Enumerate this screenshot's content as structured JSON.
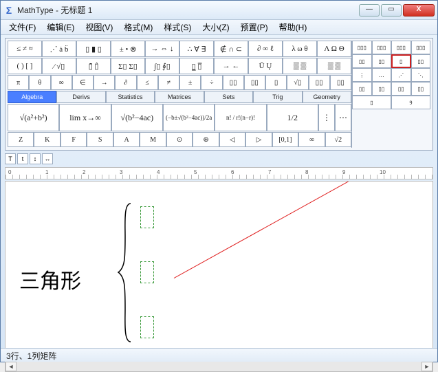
{
  "window": {
    "app_name": "MathType",
    "doc_title": "无标题 1",
    "title_full": "MathType - 无标题 1"
  },
  "win_buttons": {
    "min": "—",
    "max": "▭",
    "close": "X"
  },
  "menu": [
    "文件(F)",
    "编辑(E)",
    "视图(V)",
    "格式(M)",
    "样式(S)",
    "大小(Z)",
    "预置(P)",
    "帮助(H)"
  ],
  "toolbar_row1": [
    "≤ ≠ ≈",
    "⋰ ȧ b̈",
    "▯ ▮ ▯",
    "± • ⊗",
    "→ ⇔ ↓",
    "∴ ∀ ∃",
    "∉ ∩ ⊂",
    "∂ ∞ ℓ",
    "λ ω θ",
    "Λ Ω Θ"
  ],
  "toolbar_row2": [
    "( ) [ ]",
    "⁄ √▯",
    "▯̄ ▯̂",
    "Σ▯ Σ▯",
    "∫▯ ∮▯",
    "▯̲ ▯̅",
    "→ ←",
    "Ū Ų",
    "▒ ▒",
    "▒ ▒"
  ],
  "toolbar_row3": [
    "π",
    "θ",
    "∞",
    "∈",
    "→",
    "∂",
    "≤",
    "≠",
    "±",
    "÷",
    "▯▯",
    "▯▯",
    "▯",
    "√▯",
    "▯▯",
    "▯▯"
  ],
  "tabs": [
    {
      "label": "Algebra",
      "active": true
    },
    {
      "label": "Derivs",
      "active": false
    },
    {
      "label": "Statistics",
      "active": false
    },
    {
      "label": "Matrices",
      "active": false
    },
    {
      "label": "Sets",
      "active": false
    },
    {
      "label": "Trig",
      "active": false
    },
    {
      "label": "Geometry",
      "active": false
    }
  ],
  "tab8": "▯",
  "tab9": "9",
  "toolbar_formulas": [
    "√(a²+b²)",
    "lim x→∞",
    "√(b²−4ac)",
    "(−b±√(b²−4ac))/2a",
    "n! / r!(n−r)!",
    "1/2",
    "⋮",
    "⋯"
  ],
  "toolbar_row5": [
    "Z",
    "K",
    "F",
    "S",
    "A",
    "M",
    "⊙",
    "⊕",
    "◁",
    "▷",
    "[0,1]",
    "∞",
    "√2"
  ],
  "right_grid": [
    "▯▯▯",
    "▯▯▯",
    "▯▯▯",
    "▯▯▯",
    "▯▯",
    "▯▯",
    "▯",
    "▯▯",
    "⋮",
    "…",
    "⋰",
    "⋱",
    "▯▯",
    "▯▯",
    "▯▯",
    "▯▯"
  ],
  "highlight_index": 6,
  "mini_buttons": [
    "T",
    "t",
    "↕",
    "↔"
  ],
  "ruler_marks": [
    "0",
    "1",
    "2",
    "3",
    "4",
    "5",
    "6",
    "7",
    "8",
    "9",
    "10"
  ],
  "editor": {
    "label_text": "三角形",
    "brace": "{",
    "slots_count": 3,
    "highlight_source": "matrix-3x1-template"
  },
  "status": "3行、1列矩阵"
}
